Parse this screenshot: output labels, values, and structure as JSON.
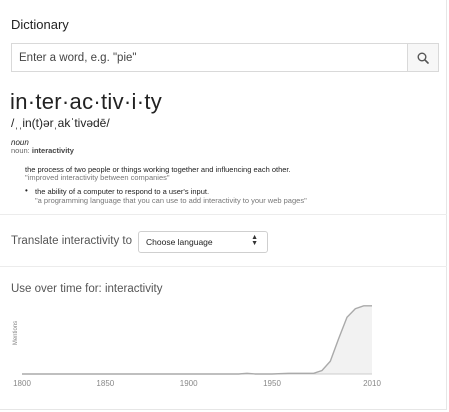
{
  "dictionary": {
    "heading": "Dictionary",
    "search": {
      "placeholder": "Enter a word, e.g. \"pie\"",
      "value": ""
    },
    "search_icon": "search-icon"
  },
  "entry": {
    "word": "in·ter·ac·tiv·i·ty",
    "pronunciation": "/ˌˌin(t)ərˌakˈtivədē/",
    "part_of_speech": "noun",
    "noun_label": "noun:",
    "noun_word": "interactivity",
    "definitions": [
      {
        "text": "the process of two people or things working together and influencing each other.",
        "example": "\"improved interactivity between companies\""
      },
      {
        "bullet": "•",
        "text": "the ability of a computer to respond to a user's input.",
        "example": "\"a programming language that you can use to add interactivity to your web pages\""
      }
    ]
  },
  "translate": {
    "label": "Translate interactivity to",
    "select_value": "Choose language"
  },
  "usage": {
    "title": "Use over time for: interactivity",
    "ylabel": "Mentions"
  },
  "chart_data": {
    "type": "area",
    "title": "Use over time for: interactivity",
    "ylabel": "Mentions",
    "xlabel": "",
    "x_ticks": [
      1800,
      1850,
      1900,
      1950,
      2010
    ],
    "xlim": [
      1800,
      2010
    ],
    "ylim": [
      0,
      1
    ],
    "series": [
      {
        "x": [
          1800,
          1850,
          1900,
          1930,
          1935,
          1940,
          1950,
          1960,
          1970,
          1975,
          1980,
          1985,
          1990,
          1995,
          2000,
          2005,
          2010
        ],
        "y": [
          0,
          0,
          0,
          0,
          0.01,
          0,
          0,
          0.01,
          0.01,
          0.01,
          0.05,
          0.18,
          0.5,
          0.8,
          0.92,
          0.96,
          0.96
        ]
      }
    ],
    "line_color": "#aaaaaa",
    "fill_color": "#f2f2f2"
  }
}
